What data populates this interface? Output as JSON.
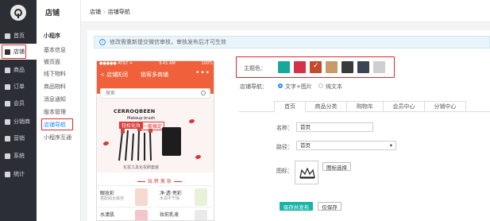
{
  "nav": {
    "items": [
      {
        "label": "首页",
        "icon": "home-icon"
      },
      {
        "label": "店铺",
        "icon": "store-icon"
      },
      {
        "label": "商品",
        "icon": "goods-icon"
      },
      {
        "label": "订单",
        "icon": "order-icon"
      },
      {
        "label": "会员",
        "icon": "member-icon"
      },
      {
        "label": "分销商",
        "icon": "distributor-icon"
      },
      {
        "label": "营销",
        "icon": "marketing-icon"
      },
      {
        "label": "系统",
        "icon": "system-icon"
      },
      {
        "label": "统计",
        "icon": "stats-icon"
      }
    ],
    "active_index": 1
  },
  "subnav": {
    "title": "店铺",
    "group": "小程序",
    "items": [
      "基本信息",
      "微页面",
      "线下物料",
      "商品物料",
      "消息通知",
      "版本管理",
      "店铺导航",
      "小程序互通"
    ],
    "active_index": 6
  },
  "breadcrumb": {
    "parent": "店铺",
    "current": "店铺导航"
  },
  "notice": "修改需重新提交微信审核，审核发布后才可生效",
  "phone": {
    "status_left": "●●●●● AT&T ✦",
    "status_time": "9:41 AM",
    "status_right": "100%",
    "back": "< 店铺",
    "close": "关闭",
    "title": "锁客多商铺",
    "more": "•••",
    "search_placeholder": "搜索",
    "brand": "CERROQBEEN",
    "brand_sub": "Makeup brush",
    "tag1": "轻松化妆",
    "tag2": "一套搞定",
    "banner_caption": "化妆工具化妆刷套装",
    "section": "玩 转 美 妆",
    "products": [
      {
        "title": "眼妆彩",
        "sub": "搭配组合最佳"
      },
      {
        "title": "净·透·亮彩",
        "sub": "水润不干燥"
      },
      {
        "title": "水漾肌",
        "sub": ""
      },
      {
        "title": "妆前乳液",
        "sub": ""
      }
    ]
  },
  "settings": {
    "theme_label": "主题色：",
    "swatches": [
      "#17a89c",
      "#d6304a",
      "#c34a2b",
      "#c99a6a",
      "#3a3a3a",
      "#3a4452",
      "#cfcfcf"
    ],
    "selected_swatch": 2,
    "nav_label": "店铺导航：",
    "radio_text_image": "文字+图片",
    "radio_text_only": "纯文本",
    "tabs": [
      "首页",
      "商品分类",
      "购物车",
      "会员中心",
      "分销中心"
    ],
    "name_label": "名称：",
    "name_value": "首页",
    "path_label": "路径：",
    "path_value": "首页",
    "icon_label": "图标：",
    "icon_button": "图标选择",
    "save_publish": "保存并发布",
    "save_only": "仅保存"
  }
}
